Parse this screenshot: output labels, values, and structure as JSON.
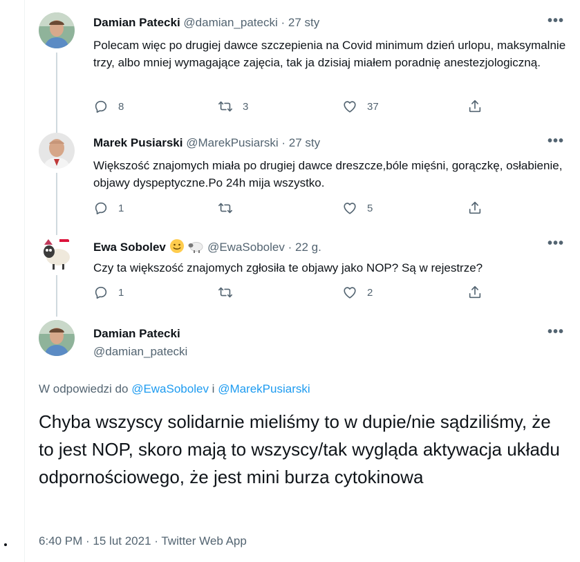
{
  "tweets": [
    {
      "name": "Damian Patecki",
      "handle": "@damian_patecki",
      "sep": "·",
      "time": "27 sty",
      "more": "•••",
      "text": "Polecam więc po drugiej dawce szczepienia na Covid minimum dzień urlopu, maksymalnie trzy, albo mniej wymagające zajęcia, tak ja dzisiaj miałem poradnię anestezjologiczną.",
      "replies": "8",
      "retweets": "3",
      "likes": "37"
    },
    {
      "name": "Marek Pusiarski",
      "handle": "@MarekPusiarski",
      "sep": "·",
      "time": "27 sty",
      "more": "•••",
      "text": "Większość znajomych miała po drugiej dawce dreszcze,bóle mięśni, gorączkę, osłabienie, objawy dyspeptyczne.Po 24h mija wszystko.",
      "replies": "1",
      "retweets": "",
      "likes": "5"
    },
    {
      "name": "Ewa Sobolev",
      "handle": "@EwaSobolev",
      "sep": "·",
      "time": "22 g.",
      "more": "•••",
      "text": "Czy ta większość znajomych zgłosiła te objawy jako NOP? Są w rejestrze?",
      "replies": "1",
      "retweets": "",
      "likes": "2"
    }
  ],
  "main": {
    "name": "Damian Patecki",
    "handle": "@damian_patecki",
    "more": "•••",
    "reply_prefix": "W odpowiedzi do ",
    "reply_user1": "@EwaSobolev",
    "reply_and": " i ",
    "reply_user2": "@MarekPusiarski",
    "text": "Chyba wszyscy solidarnie mieliśmy to w dupie/nie sądziliśmy, że to jest NOP, skoro mają to wszyscy/tak wygląda aktywacja układu odpornościowego, że jest mini burza cytokinowa",
    "meta": "6:40 PM · 15 lut 2021 · Twitter Web App"
  },
  "icons": {
    "reply": "reply-icon",
    "retweet": "retweet-icon",
    "like": "heart-icon",
    "share": "share-icon"
  },
  "colors": {
    "link": "#1d9bf0",
    "secondary": "#536471",
    "thread_line": "#cfd9de"
  }
}
